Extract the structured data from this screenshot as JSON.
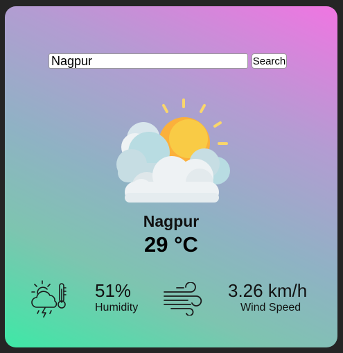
{
  "search": {
    "value": "Nagpur",
    "button_label": "Search"
  },
  "weather": {
    "icon": "sun-behind-clouds-icon",
    "city": "Nagpur",
    "temperature": "29 °C"
  },
  "details": {
    "humidity": {
      "icon": "storm-thermometer-icon",
      "value": "51%",
      "label": "Humidity"
    },
    "wind": {
      "icon": "wind-icon",
      "value": "3.26 km/h",
      "label": "Wind Speed"
    }
  },
  "colors": {
    "gradient_top": "#f075e2",
    "gradient_bottom": "#3ee8a6",
    "sun": "#fbbf2f",
    "sun_rays": "#f9d66b",
    "cloud": "#eef2f4",
    "cloud_shadow": "#b8dce2"
  }
}
